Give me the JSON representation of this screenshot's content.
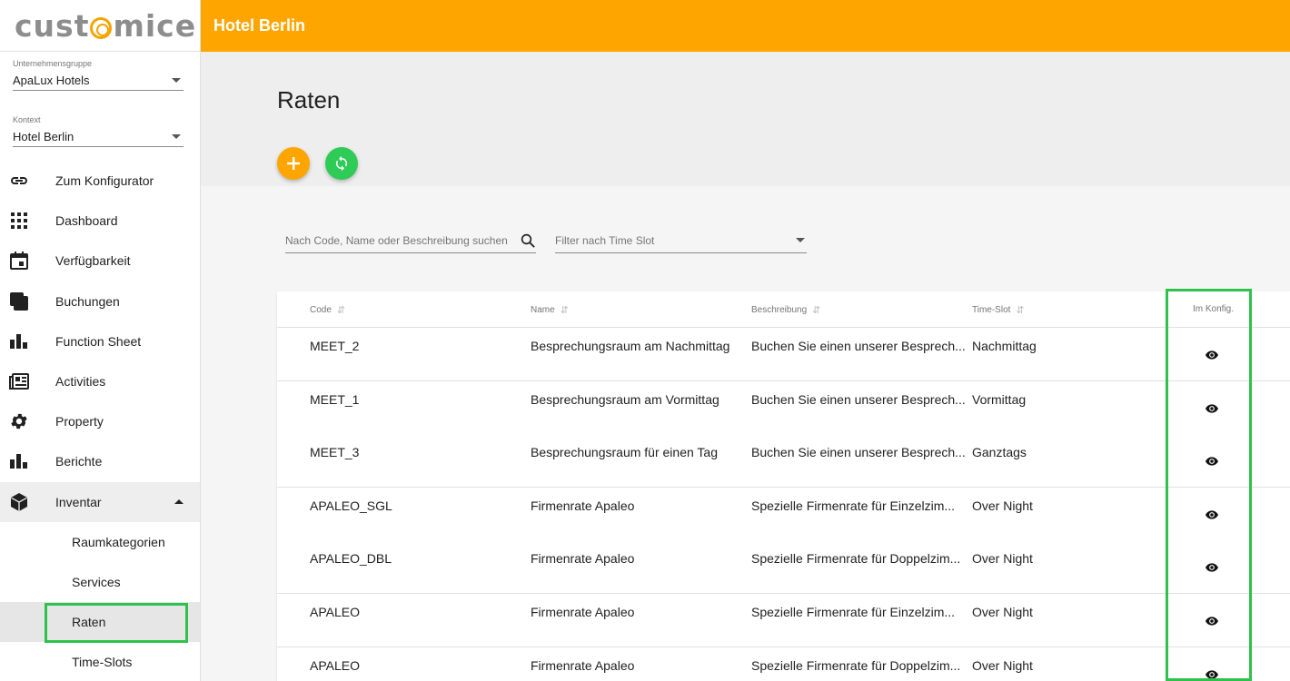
{
  "app": {
    "logo": "customice",
    "hotel_title": "Hotel Berlin"
  },
  "sidebar": {
    "group_select": {
      "label": "Unternehmensgruppe",
      "value": "ApaLux Hotels"
    },
    "context_select": {
      "label": "Kontext",
      "value": "Hotel Berlin"
    },
    "items": [
      {
        "label": "Zum Konfigurator",
        "icon": "link-icon"
      },
      {
        "label": "Dashboard",
        "icon": "grid-icon"
      },
      {
        "label": "Verfügbarkeit",
        "icon": "calendar-icon"
      },
      {
        "label": "Buchungen",
        "icon": "copy-icon"
      },
      {
        "label": "Function Sheet",
        "icon": "bar-chart-icon"
      },
      {
        "label": "Activities",
        "icon": "newspaper-icon"
      },
      {
        "label": "Property",
        "icon": "gear-icon"
      },
      {
        "label": "Berichte",
        "icon": "bar-chart-icon"
      },
      {
        "label": "Inventar",
        "icon": "box-icon"
      }
    ],
    "sub_items": [
      {
        "label": "Raumkategorien"
      },
      {
        "label": "Services"
      },
      {
        "label": "Raten"
      },
      {
        "label": "Time-Slots"
      }
    ]
  },
  "page": {
    "title": "Raten"
  },
  "search": {
    "placeholder": "Nach Code, Name oder Beschreibung suchen"
  },
  "filter": {
    "placeholder": "Filter nach Time Slot"
  },
  "table": {
    "headers": {
      "code": "Code",
      "name": "Name",
      "description": "Beschreibung",
      "timeslot": "Time-Slot",
      "in_config": "Im Konfig."
    },
    "rows": [
      {
        "code": "MEET_2",
        "name": "Besprechungsraum am Nachmittag",
        "description": "Buchen Sie einen unserer Besprech...",
        "timeslot": "Nachmittag"
      },
      {
        "code": "MEET_1",
        "name": "Besprechungsraum am Vormittag",
        "description": "Buchen Sie einen unserer Besprech...",
        "timeslot": "Vormittag"
      },
      {
        "code": "MEET_3",
        "name": "Besprechungsraum für einen Tag",
        "description": "Buchen Sie einen unserer Besprech...",
        "timeslot": "Ganztags"
      },
      {
        "code": "APALEO_SGL",
        "name": "Firmenrate Apaleo",
        "description": "Spezielle Firmenrate für Einzelzim...",
        "timeslot": "Over Night"
      },
      {
        "code": "APALEO_DBL",
        "name": "Firmenrate Apaleo",
        "description": "Spezielle Firmenrate für Doppelzim...",
        "timeslot": "Over Night"
      },
      {
        "code": "APALEO",
        "name": "Firmenrate Apaleo",
        "description": "Spezielle Firmenrate für Einzelzim...",
        "timeslot": "Over Night"
      },
      {
        "code": "APALEO",
        "name": "Firmenrate Apaleo",
        "description": "Spezielle Firmenrate für Doppelzim...",
        "timeslot": "Over Night"
      }
    ]
  },
  "colors": {
    "accent": "#ffa500",
    "refresh": "#2ecc57",
    "highlight": "#2ec24d"
  }
}
